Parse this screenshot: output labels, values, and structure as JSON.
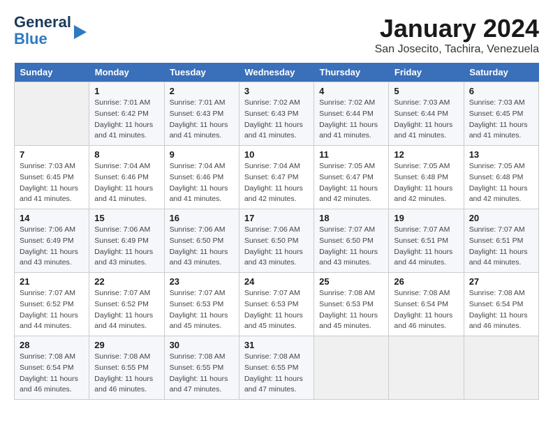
{
  "logo": {
    "line1": "General",
    "line2": "Blue"
  },
  "title": "January 2024",
  "subtitle": "San Josecito, Tachira, Venezuela",
  "days_of_week": [
    "Sunday",
    "Monday",
    "Tuesday",
    "Wednesday",
    "Thursday",
    "Friday",
    "Saturday"
  ],
  "weeks": [
    [
      {
        "day": "",
        "info": ""
      },
      {
        "day": "1",
        "info": "Sunrise: 7:01 AM\nSunset: 6:42 PM\nDaylight: 11 hours\nand 41 minutes."
      },
      {
        "day": "2",
        "info": "Sunrise: 7:01 AM\nSunset: 6:43 PM\nDaylight: 11 hours\nand 41 minutes."
      },
      {
        "day": "3",
        "info": "Sunrise: 7:02 AM\nSunset: 6:43 PM\nDaylight: 11 hours\nand 41 minutes."
      },
      {
        "day": "4",
        "info": "Sunrise: 7:02 AM\nSunset: 6:44 PM\nDaylight: 11 hours\nand 41 minutes."
      },
      {
        "day": "5",
        "info": "Sunrise: 7:03 AM\nSunset: 6:44 PM\nDaylight: 11 hours\nand 41 minutes."
      },
      {
        "day": "6",
        "info": "Sunrise: 7:03 AM\nSunset: 6:45 PM\nDaylight: 11 hours\nand 41 minutes."
      }
    ],
    [
      {
        "day": "7",
        "info": "Sunrise: 7:03 AM\nSunset: 6:45 PM\nDaylight: 11 hours\nand 41 minutes."
      },
      {
        "day": "8",
        "info": "Sunrise: 7:04 AM\nSunset: 6:46 PM\nDaylight: 11 hours\nand 41 minutes."
      },
      {
        "day": "9",
        "info": "Sunrise: 7:04 AM\nSunset: 6:46 PM\nDaylight: 11 hours\nand 41 minutes."
      },
      {
        "day": "10",
        "info": "Sunrise: 7:04 AM\nSunset: 6:47 PM\nDaylight: 11 hours\nand 42 minutes."
      },
      {
        "day": "11",
        "info": "Sunrise: 7:05 AM\nSunset: 6:47 PM\nDaylight: 11 hours\nand 42 minutes."
      },
      {
        "day": "12",
        "info": "Sunrise: 7:05 AM\nSunset: 6:48 PM\nDaylight: 11 hours\nand 42 minutes."
      },
      {
        "day": "13",
        "info": "Sunrise: 7:05 AM\nSunset: 6:48 PM\nDaylight: 11 hours\nand 42 minutes."
      }
    ],
    [
      {
        "day": "14",
        "info": "Sunrise: 7:06 AM\nSunset: 6:49 PM\nDaylight: 11 hours\nand 43 minutes."
      },
      {
        "day": "15",
        "info": "Sunrise: 7:06 AM\nSunset: 6:49 PM\nDaylight: 11 hours\nand 43 minutes."
      },
      {
        "day": "16",
        "info": "Sunrise: 7:06 AM\nSunset: 6:50 PM\nDaylight: 11 hours\nand 43 minutes."
      },
      {
        "day": "17",
        "info": "Sunrise: 7:06 AM\nSunset: 6:50 PM\nDaylight: 11 hours\nand 43 minutes."
      },
      {
        "day": "18",
        "info": "Sunrise: 7:07 AM\nSunset: 6:50 PM\nDaylight: 11 hours\nand 43 minutes."
      },
      {
        "day": "19",
        "info": "Sunrise: 7:07 AM\nSunset: 6:51 PM\nDaylight: 11 hours\nand 44 minutes."
      },
      {
        "day": "20",
        "info": "Sunrise: 7:07 AM\nSunset: 6:51 PM\nDaylight: 11 hours\nand 44 minutes."
      }
    ],
    [
      {
        "day": "21",
        "info": "Sunrise: 7:07 AM\nSunset: 6:52 PM\nDaylight: 11 hours\nand 44 minutes."
      },
      {
        "day": "22",
        "info": "Sunrise: 7:07 AM\nSunset: 6:52 PM\nDaylight: 11 hours\nand 44 minutes."
      },
      {
        "day": "23",
        "info": "Sunrise: 7:07 AM\nSunset: 6:53 PM\nDaylight: 11 hours\nand 45 minutes."
      },
      {
        "day": "24",
        "info": "Sunrise: 7:07 AM\nSunset: 6:53 PM\nDaylight: 11 hours\nand 45 minutes."
      },
      {
        "day": "25",
        "info": "Sunrise: 7:08 AM\nSunset: 6:53 PM\nDaylight: 11 hours\nand 45 minutes."
      },
      {
        "day": "26",
        "info": "Sunrise: 7:08 AM\nSunset: 6:54 PM\nDaylight: 11 hours\nand 46 minutes."
      },
      {
        "day": "27",
        "info": "Sunrise: 7:08 AM\nSunset: 6:54 PM\nDaylight: 11 hours\nand 46 minutes."
      }
    ],
    [
      {
        "day": "28",
        "info": "Sunrise: 7:08 AM\nSunset: 6:54 PM\nDaylight: 11 hours\nand 46 minutes."
      },
      {
        "day": "29",
        "info": "Sunrise: 7:08 AM\nSunset: 6:55 PM\nDaylight: 11 hours\nand 46 minutes."
      },
      {
        "day": "30",
        "info": "Sunrise: 7:08 AM\nSunset: 6:55 PM\nDaylight: 11 hours\nand 47 minutes."
      },
      {
        "day": "31",
        "info": "Sunrise: 7:08 AM\nSunset: 6:55 PM\nDaylight: 11 hours\nand 47 minutes."
      },
      {
        "day": "",
        "info": ""
      },
      {
        "day": "",
        "info": ""
      },
      {
        "day": "",
        "info": ""
      }
    ]
  ]
}
